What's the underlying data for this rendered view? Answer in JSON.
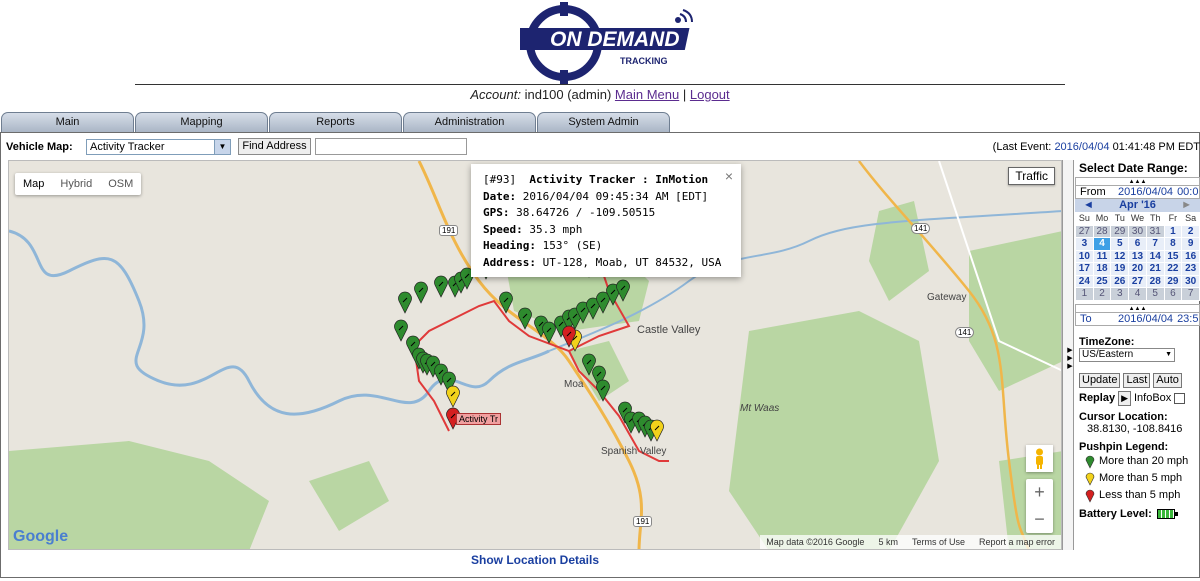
{
  "header": {
    "logo_text_main": "ON DEMAND",
    "logo_text_sub": "TRACKING",
    "account_label": "Account:",
    "account_value": "ind100 (admin)",
    "main_menu_link": "Main Menu",
    "separator": "|",
    "logout_link": "Logout"
  },
  "tabs": [
    {
      "label": "Main"
    },
    {
      "label": "Mapping"
    },
    {
      "label": "Reports"
    },
    {
      "label": "Administration"
    },
    {
      "label": "System Admin"
    }
  ],
  "toolbar": {
    "vehicle_map_label": "Vehicle Map:",
    "vehicle_map_value": "Activity Tracker",
    "find_address_button": "Find Address",
    "find_address_value": "",
    "last_event_prefix": "(Last Event:",
    "last_event_date": "2016/04/04",
    "last_event_time": "01:41:48 PM EDT"
  },
  "map": {
    "type_buttons": [
      "Map",
      "Hybrid",
      "OSM"
    ],
    "traffic_button": "Traffic",
    "places": [
      "Castle Valley",
      "Gateway",
      "Mt Waas",
      "Moa",
      "Spanish Valley"
    ],
    "route_shields": [
      "191",
      "141",
      "141",
      "191"
    ],
    "pin_label": "Activity Tr",
    "google": "Google",
    "attribution": [
      "Map data ©2016 Google",
      "5 km",
      "Terms of Use",
      "Report a map error"
    ],
    "zoom_in": "+",
    "zoom_out": "−",
    "route_color": "#e03a3a",
    "infobox": {
      "id": "[#93]",
      "title": "Activity Tracker : InMotion",
      "date_label": "Date:",
      "date_value": "2016/04/04 09:45:34 AM [EDT]",
      "gps_label": "GPS:",
      "gps_value": "38.64726 / -109.50515",
      "speed_label": "Speed:",
      "speed_value": "35.3 mph",
      "heading_label": "Heading:",
      "heading_value": "153° (SE)",
      "address_label": "Address:",
      "address_value": "UT-128, Moab, UT 84532, USA",
      "close": "×"
    }
  },
  "show_details": "Show Location Details",
  "sidebar": {
    "title": "Select Date Range:",
    "from_label": "From",
    "from_date": "2016/04/04",
    "from_time": "00:0",
    "month": "Apr '16",
    "prev": "◄",
    "next": "►",
    "dow": [
      "Su",
      "Mo",
      "Tu",
      "We",
      "Th",
      "Fr",
      "Sa"
    ],
    "weeks": [
      [
        "27",
        "28",
        "29",
        "30",
        "31",
        "1",
        "2"
      ],
      [
        "3",
        "4",
        "5",
        "6",
        "7",
        "8",
        "9"
      ],
      [
        "10",
        "11",
        "12",
        "13",
        "14",
        "15",
        "16"
      ],
      [
        "17",
        "18",
        "19",
        "20",
        "21",
        "22",
        "23"
      ],
      [
        "24",
        "25",
        "26",
        "27",
        "28",
        "29",
        "30"
      ],
      [
        "1",
        "2",
        "3",
        "4",
        "5",
        "6",
        "7"
      ]
    ],
    "to_label": "To",
    "to_date": "2016/04/04",
    "to_time": "23:5",
    "timezone_label": "TimeZone:",
    "timezone_value": "US/Eastern",
    "update_button": "Update",
    "last_button": "Last",
    "auto_button": "Auto",
    "replay_label": "Replay",
    "infobox_label": "InfoBox",
    "cursor_label": "Cursor Location:",
    "cursor_value": "38.8130, -108.8416",
    "legend_title": "Pushpin Legend:",
    "legend": [
      {
        "label": "More than 20 mph",
        "color": "#2e8b2e"
      },
      {
        "label": "More than 5 mph",
        "color": "#f2d21b"
      },
      {
        "label": "Less than 5 mph",
        "color": "#d42020"
      }
    ],
    "battery_label": "Battery Level:"
  }
}
